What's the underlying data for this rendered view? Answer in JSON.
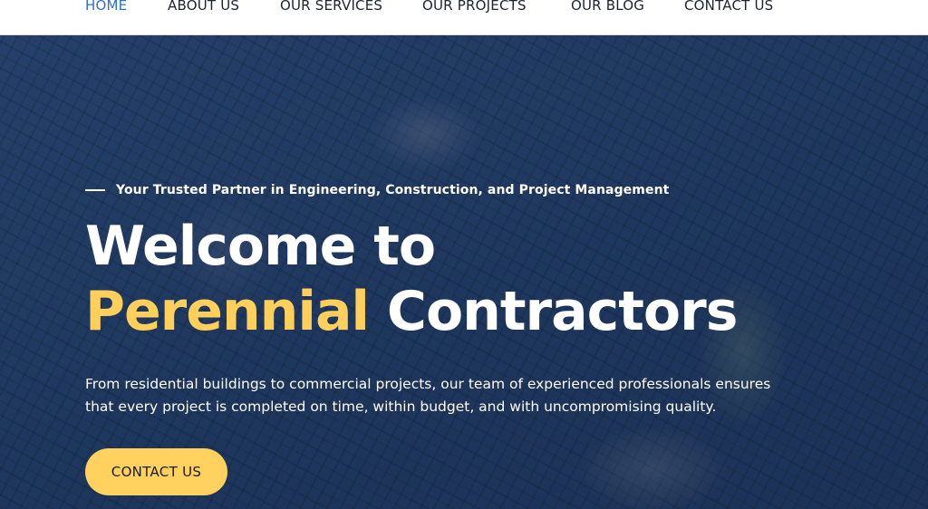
{
  "nav": {
    "items": [
      {
        "label": "HOME",
        "active": true
      },
      {
        "label": "ABOUT US",
        "active": false
      },
      {
        "label": "OUR SERVICES",
        "active": false
      },
      {
        "label": "OUR PROJECTS",
        "active": false
      },
      {
        "label": "OUR BLOG",
        "active": false
      },
      {
        "label": "CONTACT US",
        "active": false
      }
    ]
  },
  "hero": {
    "tagline": "Your Trusted Partner in Engineering, Construction, and Project Management",
    "headline_line1": "Welcome to",
    "headline_accent": "Perennial",
    "headline_rest": "Contractors",
    "description_line1": "From residential buildings to commercial projects, our team of experienced professionals ensures",
    "description_line2": "that every project is completed on time, within budget, and with uncompromising quality.",
    "cta_label": "CONTACT US"
  },
  "colors": {
    "accent_yellow": "#ffcf5c",
    "nav_active": "#2f6fd0",
    "hero_overlay": "#24406a"
  }
}
